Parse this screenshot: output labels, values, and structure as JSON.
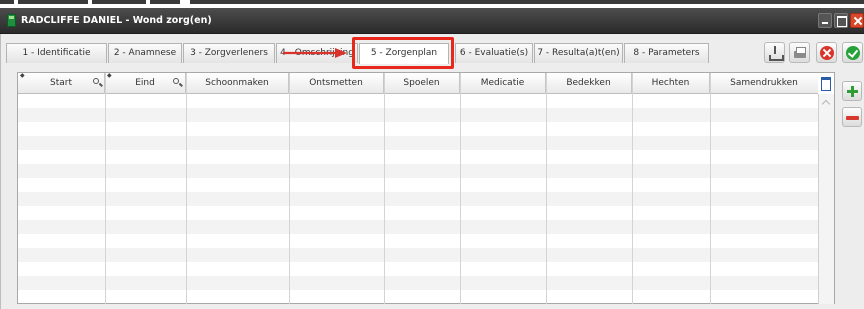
{
  "window": {
    "title": "RADCLIFFE DANIEL - Wond zorg(en)",
    "controls": {
      "minimize_icon": "minimize-icon",
      "maximize_icon": "maximize-icon",
      "close_icon": "close-icon"
    }
  },
  "tabs": [
    {
      "label": "1 - Identificatie"
    },
    {
      "label": "2 - Anamnese"
    },
    {
      "label": "3 - Zorgverleners"
    },
    {
      "label": "4 - Omschrijving"
    },
    {
      "label": "5 - Zorgenplan",
      "active": true
    },
    {
      "label": "6 - Evaluatie(s)"
    },
    {
      "label": "7 - Resulta(a)t(en)"
    },
    {
      "label": "8 - Parameters"
    }
  ],
  "toolbar": {
    "icons": [
      "download-icon",
      "print-icon",
      "cancel-icon",
      "confirm-icon"
    ]
  },
  "grid": {
    "columns": [
      {
        "label": "Start",
        "filterable": true,
        "sortable": true
      },
      {
        "label": "Eind",
        "filterable": true,
        "sortable": true
      },
      {
        "label": "Schoonmaken"
      },
      {
        "label": "Ontsmetten"
      },
      {
        "label": "Spoelen"
      },
      {
        "label": "Medicatie"
      },
      {
        "label": "Bedekken"
      },
      {
        "label": "Hechten"
      },
      {
        "label": "Samendrukken"
      }
    ],
    "rows": []
  },
  "side_actions": {
    "icons": [
      "add-icon",
      "remove-icon"
    ]
  },
  "colors": {
    "titlebar": "#3a3a3a",
    "highlight": "#e8281d",
    "add": "#2f9c34",
    "remove": "#d6392d",
    "confirm": "#27a13a",
    "cancel": "#d8352b"
  }
}
